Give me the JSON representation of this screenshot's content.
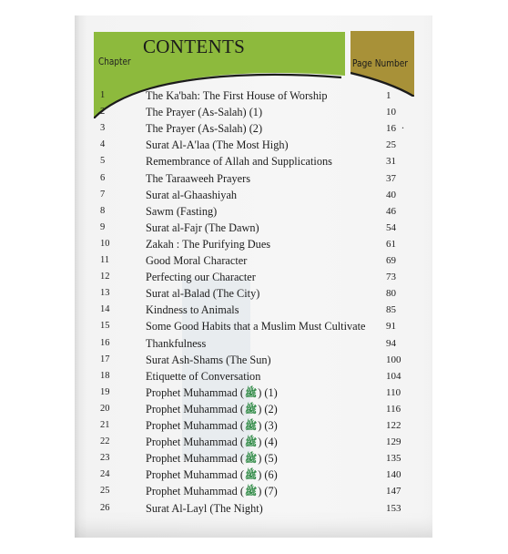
{
  "header": {
    "title": "CONTENTS",
    "chapter_label": "Chapter",
    "page_label": "Page Number"
  },
  "colors": {
    "green": "#8dba3d",
    "gold": "#a89138",
    "honorific": "#2f8a45"
  },
  "honorific_icon": "pbuh-calligraphy-icon",
  "entries": [
    {
      "chapter": "1",
      "title": "The Ka'bah: The First House of Worship",
      "page": "1"
    },
    {
      "chapter": "2",
      "title": "The Prayer (As-Salah) (1)",
      "page": "10"
    },
    {
      "chapter": "3",
      "title": "The Prayer (As-Salah) (2)",
      "page": "16"
    },
    {
      "chapter": "4",
      "title": "Surat Al-A'laa (The Most High)",
      "page": "25"
    },
    {
      "chapter": "5",
      "title": "Remembrance of Allah and Supplications",
      "page": "31"
    },
    {
      "chapter": "6",
      "title": "The Taraaweeh Prayers",
      "page": "37"
    },
    {
      "chapter": "7",
      "title": "Surat al-Ghaashiyah",
      "page": "40"
    },
    {
      "chapter": "8",
      "title": "Sawm (Fasting)",
      "page": "46"
    },
    {
      "chapter": "9",
      "title": "Surat al-Fajr (The Dawn)",
      "page": "54"
    },
    {
      "chapter": "10",
      "title": "Zakah : The Purifying Dues",
      "page": "61"
    },
    {
      "chapter": "11",
      "title": "Good Moral Character",
      "page": "69"
    },
    {
      "chapter": "12",
      "title": "Perfecting our Character",
      "page": "73"
    },
    {
      "chapter": "13",
      "title": "Surat al-Balad (The City)",
      "page": "80"
    },
    {
      "chapter": "14",
      "title": "Kindness to Animals",
      "page": "85"
    },
    {
      "chapter": "15",
      "title": "Some Good Habits that a Muslim Must Cultivate",
      "page": "91"
    },
    {
      "chapter": "16",
      "title": "Thankfulness",
      "page": "94"
    },
    {
      "chapter": "17",
      "title": "Surat Ash-Shams (The Sun)",
      "page": "100"
    },
    {
      "chapter": "18",
      "title": "Etiquette of Conversation",
      "page": "104"
    },
    {
      "chapter": "19",
      "title": "Prophet Muhammad",
      "suffix": "(1)",
      "honorific": "ﷺ",
      "page": "110"
    },
    {
      "chapter": "20",
      "title": "Prophet Muhammad",
      "suffix": "(2)",
      "honorific": "ﷺ",
      "page": "116"
    },
    {
      "chapter": "21",
      "title": "Prophet Muhammad",
      "suffix": "(3)",
      "honorific": "ﷺ",
      "page": "122"
    },
    {
      "chapter": "22",
      "title": "Prophet Muhammad",
      "suffix": "(4)",
      "honorific": "ﷺ",
      "page": "129"
    },
    {
      "chapter": "23",
      "title": "Prophet Muhammad",
      "suffix": "(5)",
      "honorific": "ﷺ",
      "page": "135"
    },
    {
      "chapter": "24",
      "title": "Prophet Muhammad",
      "suffix": "(6)",
      "honorific": "ﷺ",
      "page": "140"
    },
    {
      "chapter": "25",
      "title": "Prophet Muhammad",
      "suffix": "(7)",
      "honorific": "ﷺ",
      "page": "147"
    },
    {
      "chapter": "26",
      "title": "Surat Al-Layl (The Night)",
      "page": "153"
    }
  ]
}
